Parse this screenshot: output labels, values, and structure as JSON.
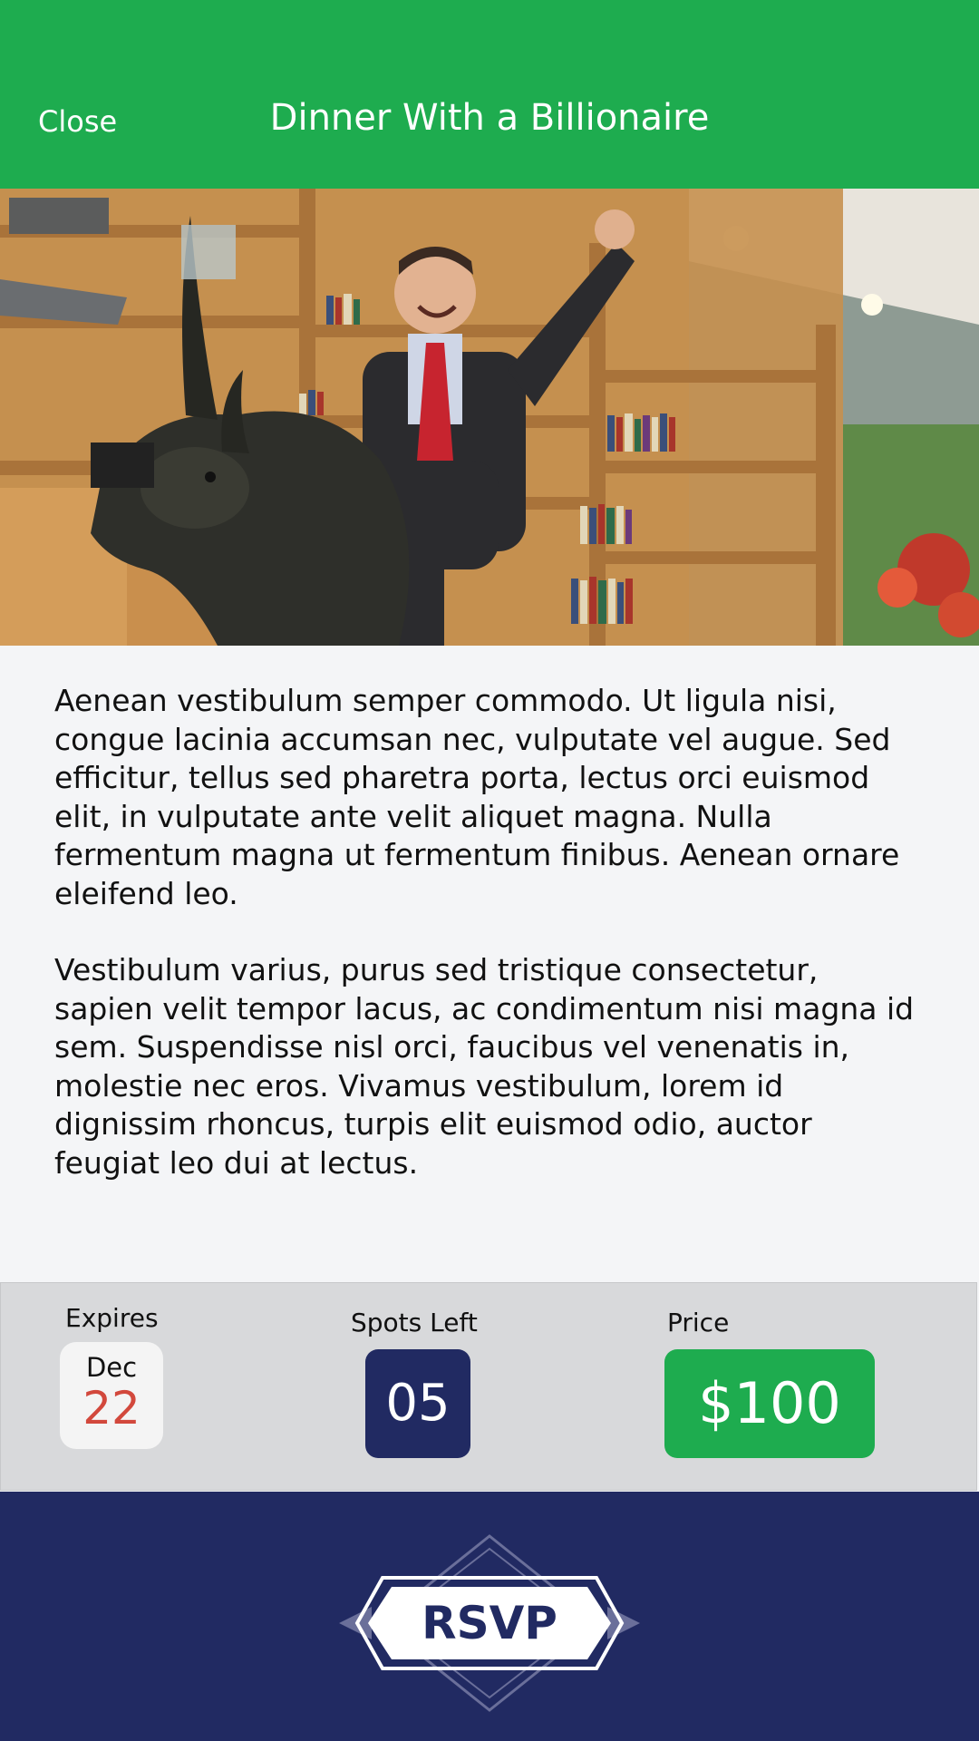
{
  "header": {
    "close_label": "Close",
    "title": "Dinner With a Billionaire"
  },
  "hero": {
    "image": "man-riding-rhino-sculpture-photo"
  },
  "description": {
    "paragraphs": [
      "Aenean vestibulum semper commodo. Ut ligula nisi, congue lacinia accumsan nec, vulputate vel augue. Sed efficitur, tellus sed pharetra porta, lectus orci euismod elit, in vulputate ante velit aliquet magna. Nulla fermentum magna ut fermentum finibus. Aenean ornare eleifend leo.",
      "Vestibulum varius, purus sed tristique consectetur, sapien velit tempor lacus, ac condimentum nisi magna id sem. Suspendisse nisl orci, faucibus vel venenatis in, molestie nec eros. Vivamus vestibulum, lorem id dignissim rhoncus, turpis elit euismod odio, auctor feugiat leo dui at lectus."
    ]
  },
  "stats": {
    "expires": {
      "label": "Expires",
      "month": "Dec",
      "day": "22"
    },
    "spots": {
      "label": "Spots Left",
      "value": "05"
    },
    "price": {
      "label": "Price",
      "value": "$100"
    }
  },
  "footer": {
    "rsvp_label": "RSVP"
  },
  "colors": {
    "brand_green": "#1eac4f",
    "navy": "#212a62",
    "date_red": "#d2483c",
    "stats_bg": "#d8d9db",
    "page_bg": "#f4f5f7"
  }
}
